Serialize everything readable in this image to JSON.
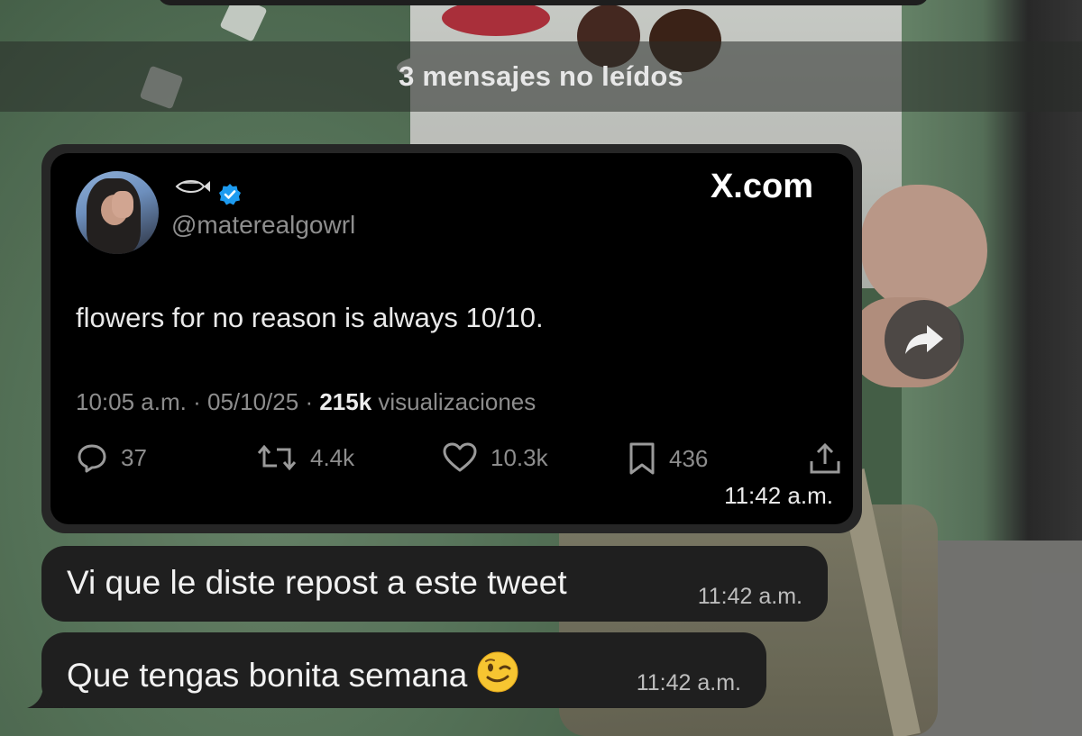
{
  "unread_banner": {
    "text": "3 mensajes no leídos"
  },
  "tweet_card": {
    "name_icon": "fish-icon",
    "verified_icon": "verified-badge-icon",
    "handle": "@materealgowrl",
    "source": "X.com",
    "text": "flowers for no reason is always 10/10.",
    "time": "10:05 a.m.",
    "date": "05/10/25",
    "views_count": "215k",
    "views_label": "visualizaciones",
    "replies": "37",
    "reposts": "4.4k",
    "likes": "10.3k",
    "bookmarks": "436",
    "sent_time": "11:42 a.m."
  },
  "messages": [
    {
      "text": "Vi que le diste repost a este tweet",
      "time": "11:42 a.m."
    },
    {
      "text": "Que tengas bonita semana",
      "emoji": "winking-face",
      "time": "11:42 a.m."
    }
  ],
  "colors": {
    "bubble": "#1f1f1f",
    "card": "#000000",
    "verified": "#1d9bf0",
    "muted": "#8d8d8d"
  }
}
